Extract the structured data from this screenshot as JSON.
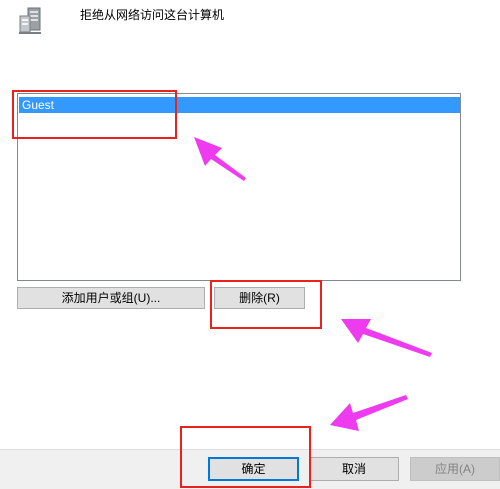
{
  "policy": {
    "title": "拒绝从网络访问这台计算机",
    "icon": "server-policy-icon"
  },
  "accounts": {
    "items": [
      {
        "label": "Guest",
        "selected": true
      }
    ]
  },
  "actions": {
    "add_label": "添加用户或组(U)...",
    "remove_label": "删除(R)"
  },
  "footer": {
    "ok_label": "确定",
    "cancel_label": "取消",
    "apply_label": "应用(A)",
    "apply_enabled": false
  },
  "colors": {
    "selection": "#3399ff",
    "highlight": "#e8231e",
    "arrow": "#ee3bef",
    "default_button_border": "#0078d7"
  }
}
